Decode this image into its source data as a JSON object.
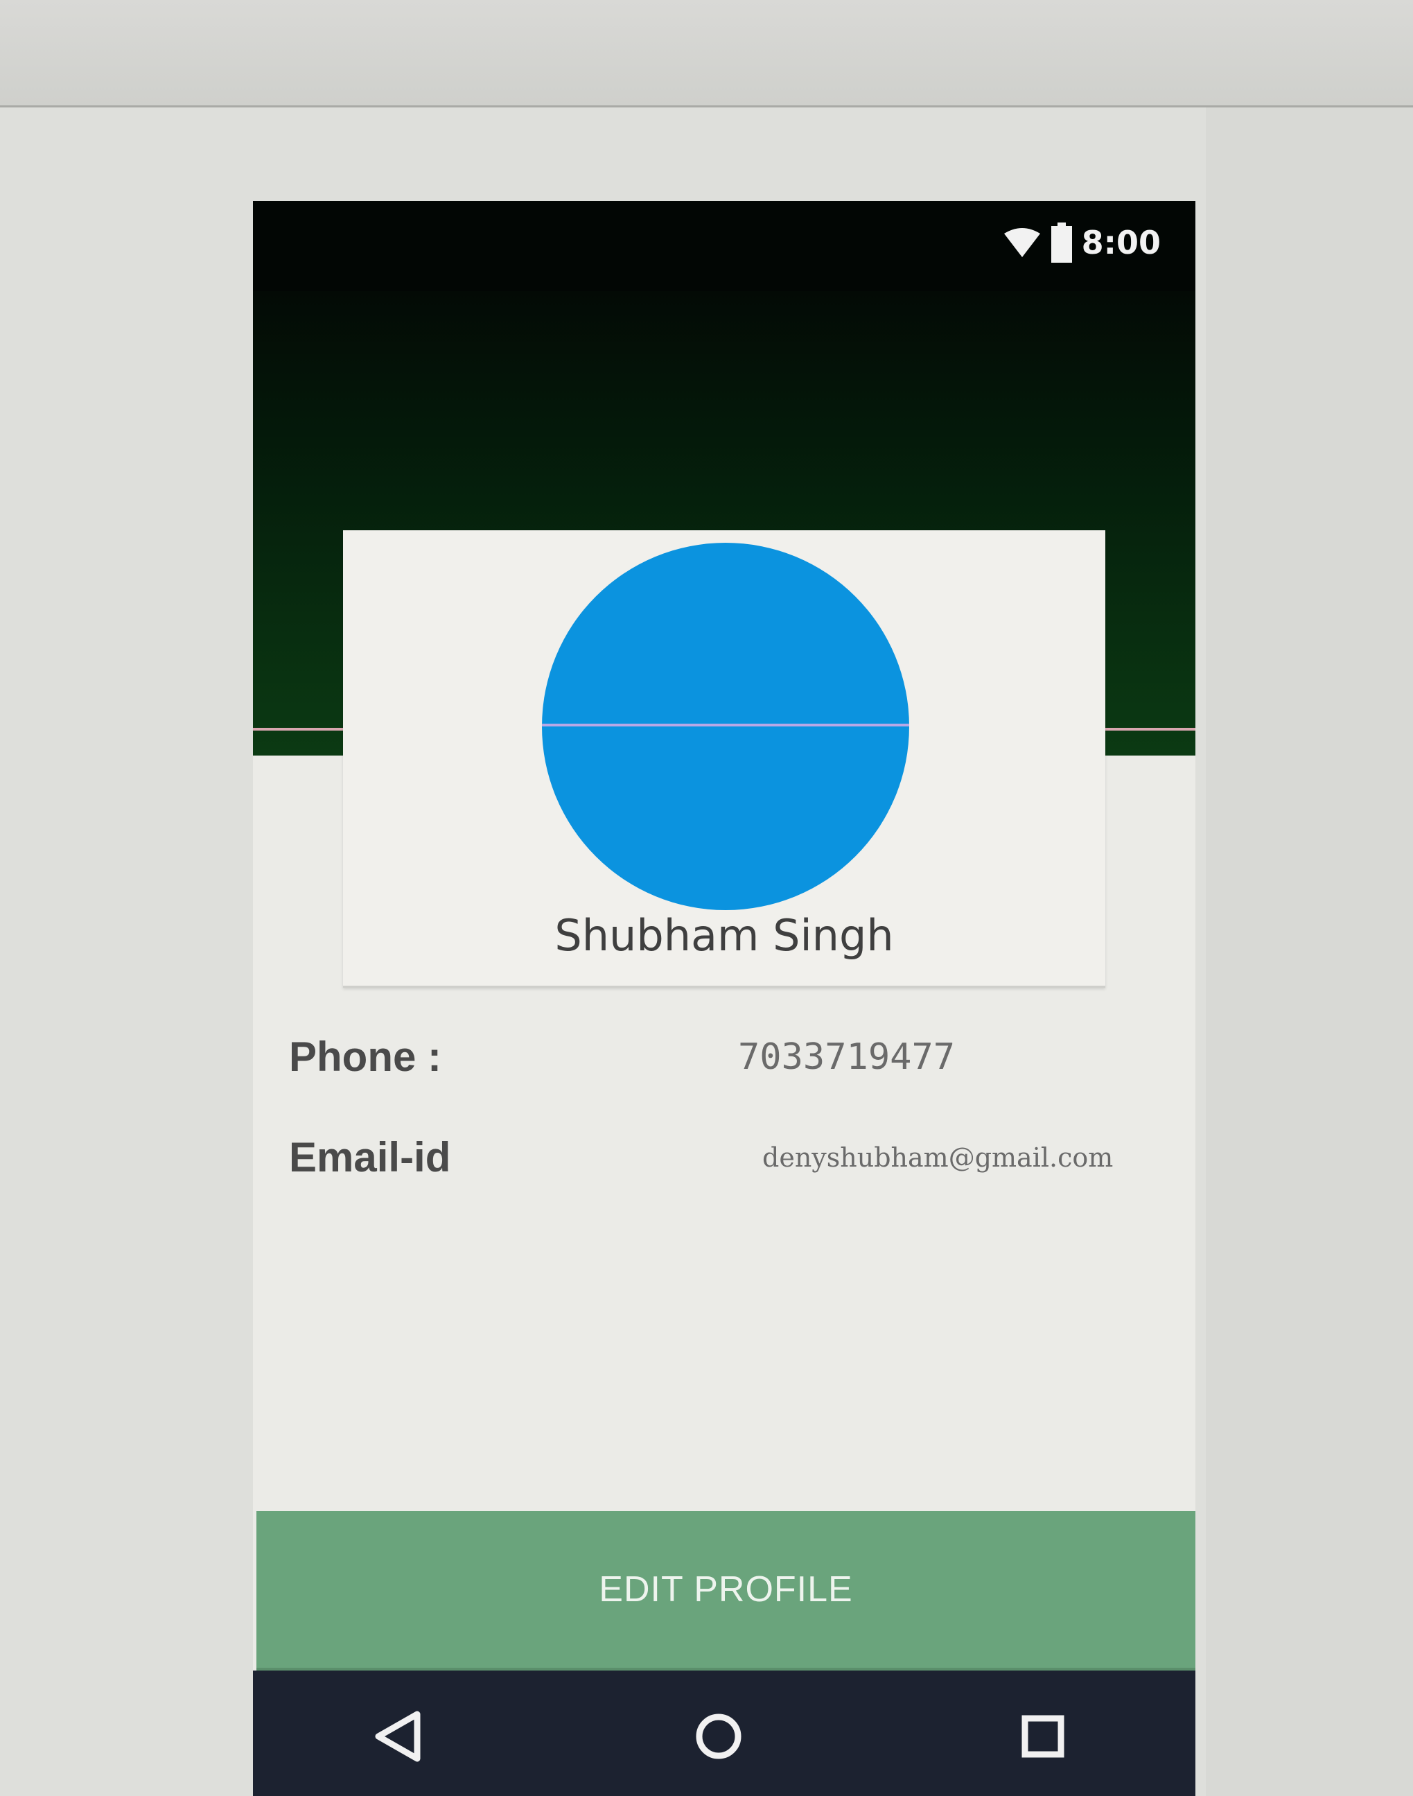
{
  "status_bar": {
    "time": "8:00",
    "icons": [
      "wifi-icon",
      "battery-icon"
    ]
  },
  "profile": {
    "name": "Shubham Singh",
    "avatar_color": "#0b93df"
  },
  "details": {
    "phone_label": "Phone :",
    "phone_value": "7033719477",
    "email_label": "Email-id",
    "email_value": "denyshubham@gmail.com"
  },
  "actions": {
    "edit_profile_label": "EDIT PROFILE"
  },
  "nav_bar": {
    "buttons": [
      "back-icon",
      "home-icon",
      "recent-apps-icon"
    ]
  },
  "colors": {
    "header_dark_green": "#0b3a13",
    "button_green": "#6aa47c",
    "nav_bar": "#1c2230"
  }
}
